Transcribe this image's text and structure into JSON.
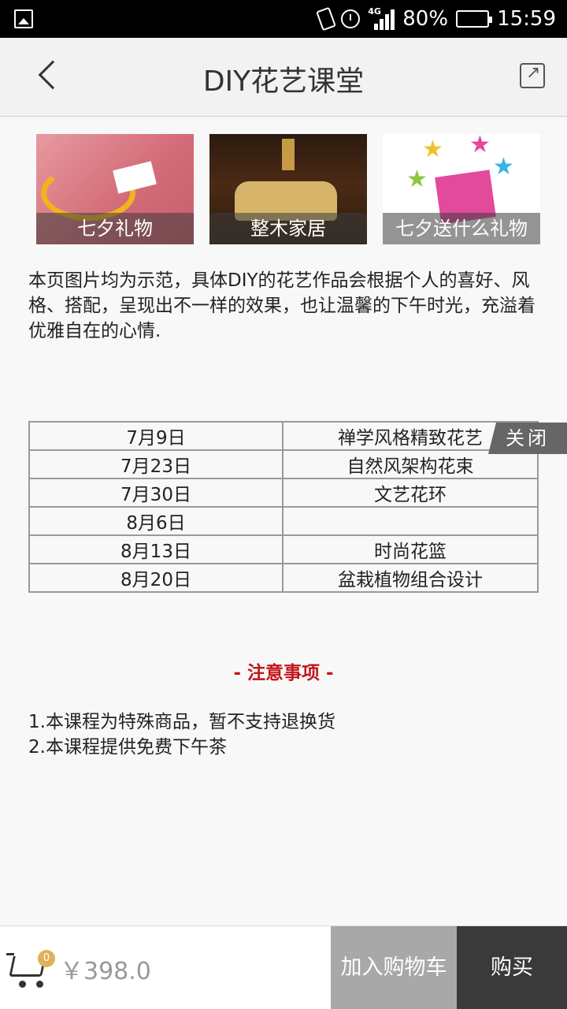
{
  "status_bar": {
    "network": "4G",
    "battery": "80%",
    "time": "15:59"
  },
  "header": {
    "title": "DIY花艺课堂"
  },
  "thumbnails": [
    {
      "caption": "七夕礼物"
    },
    {
      "caption": "整木家居"
    },
    {
      "caption": "七夕送什么礼物"
    }
  ],
  "description": "本页图片均为示范，具体DIY的花艺作品会根据个人的喜好、风格、搭配，呈现出不一样的效果，也让温馨的下午时光，充溢着优雅自在的心情.",
  "schedule": [
    {
      "date": "7月9日",
      "topic": "禅学风格精致花艺"
    },
    {
      "date": "7月23日",
      "topic": "自然风架构花束"
    },
    {
      "date": "7月30日",
      "topic": "文艺花环"
    },
    {
      "date": "8月6日",
      "topic": ""
    },
    {
      "date": "8月13日",
      "topic": "时尚花篮"
    },
    {
      "date": "8月20日",
      "topic": "盆栽植物组合设计"
    }
  ],
  "close_label": "关闭",
  "notice": {
    "title": "- 注意事项 -",
    "items": [
      "1.本课程为特殊商品，暂不支持退换货",
      "2.本课程提供免费下午茶"
    ]
  },
  "bottom_bar": {
    "cart_count": "0",
    "price": "￥398.0",
    "add_to_cart": "加入购物车",
    "buy": "购买"
  }
}
